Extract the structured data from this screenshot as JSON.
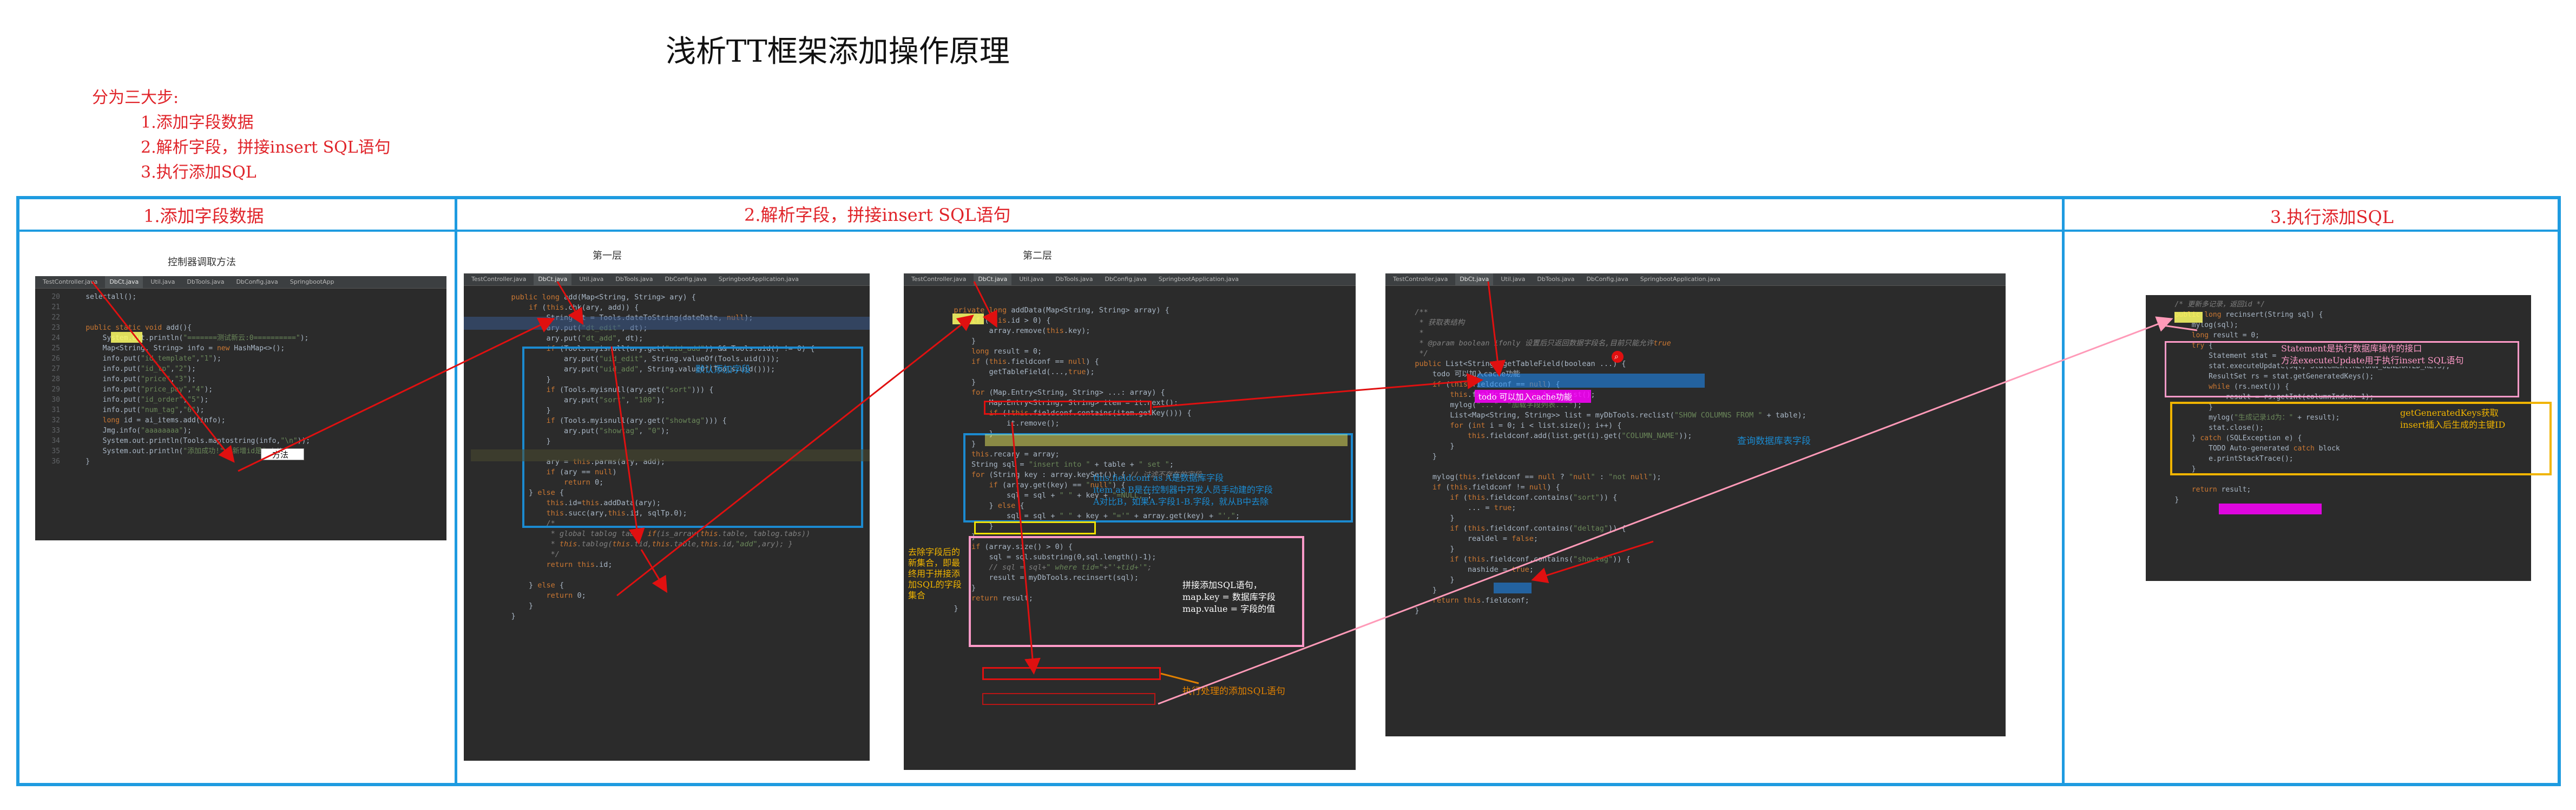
{
  "title": "浅析TT框架添加操作原理",
  "steps": {
    "intro": "分为三大步:",
    "items": [
      "1.添加字段数据",
      "2.解析字段，拼接insert SQL语句",
      "3.执行添加SQL"
    ]
  },
  "sections": {
    "s1": "1.添加字段数据",
    "s2": "2.解析字段，拼接insert SQL语句",
    "s3": "3.执行添加SQL"
  },
  "labels": {
    "p1_caption": "控制器调取方法",
    "p2_caption": "第一层",
    "p3_caption": "第二层"
  },
  "panel1": {
    "tabs": [
      "TestController.java",
      "DbCt.java",
      "Util.java",
      "DbTools.java",
      "DbConfig.java",
      "SpringbootApp"
    ],
    "lines": [
      {
        "n": "20",
        "t": "    selectall();"
      },
      {
        "n": "21",
        "t": ""
      },
      {
        "n": "22",
        "t": ""
      },
      {
        "n": "23",
        "t": "    public static void add(){"
      },
      {
        "n": "24",
        "t": "        System.out.println(\"=======测试新云:0==========\");"
      },
      {
        "n": "25",
        "t": "        Map<String, String> info = new HashMap<>();"
      },
      {
        "n": "26",
        "t": "        info.put(\"id_template\",\"1\");"
      },
      {
        "n": "27",
        "t": "        info.put(\"id_tp\",\"2\");"
      },
      {
        "n": "28",
        "t": "        info.put(\"price\",\"3\");"
      },
      {
        "n": "29",
        "t": "        info.put(\"price_pay\",\"4\");"
      },
      {
        "n": "30",
        "t": "        info.put(\"id_order\",\"5\");"
      },
      {
        "n": "31",
        "t": "        info.put(\"num_tag\",\"6\");"
      },
      {
        "n": "32",
        "t": "        long id = ai_items.add(info);"
      },
      {
        "n": "33",
        "t": "        Jmg.info(\"aaaaaaaa\");"
      },
      {
        "n": "34",
        "t": "        System.out.println(Tools.maptostring(info,\"\\n\"));"
      },
      {
        "n": "35",
        "t": "        System.out.println(\"添加成功!\"+\"新增id是\"+id);"
      },
      {
        "n": "36",
        "t": "    }"
      }
    ],
    "method_tag": "方法"
  },
  "panel2": {
    "tabs": [
      "TestController.java",
      "DbCt.java",
      "Util.java",
      "DbTools.java",
      "DbConfig.java",
      "SpringbootApplication.java"
    ],
    "lines": [
      "    public long add(Map<String, String> ary) {",
      "        if (this.chk(ary, add)) {",
      "            String dt = Tools.dateToString(dateDate, null);",
      "            ary.put(\"dt_edit\", dt);",
      "            ary.put(\"dt_add\", dt);",
      "            if (Tools.myisnull(ary.get(\"uid_add\")) && Tools.uid() != 0) {",
      "                ary.put(\"uid_edit\", String.valueOf(Tools.uid()));",
      "                ary.put(\"uid_add\", String.valueOf(Tools.uid()));",
      "            }",
      "            if (Tools.myisnull(ary.get(\"sort\"))) {",
      "                ary.put(\"sort\", \"100\");",
      "            }",
      "            if (Tools.myisnull(ary.get(\"showtag\"))) {",
      "                ary.put(\"showtag\", \"0\");",
      "            }",
      "",
      "            ary = this.parms(ary, add);",
      "            if (ary == null)",
      "                return 0;",
      "        } else {",
      "            this.id=this.addData(ary);",
      "            this.succ(ary,this.id, sqlTp.0);",
      "            /*",
      "             * global tablog tabs: if(is_array(this.table, tablog.tabs))",
      "             * this.tablog(this.tid,this.table,this.id,\"add\",ary); }",
      "             */",
      "            return this.id;",
      "",
      "        } else {",
      "            return 0;",
      "        }",
      "    }"
    ],
    "box_note": "默认添加字段"
  },
  "panel3": {
    "tabs": [
      "TestController.java",
      "DbCt.java",
      "Util.java",
      "DbTools.java",
      "DbConfig.java",
      "SpringbootApplication.java"
    ],
    "lines": [
      "    private long addData(Map<String, String> array) {",
      "        if (this.id > 0) {",
      "            array.remove(this.key);",
      "        }",
      "        long result = 0;",
      "        if (this.fieldconf == null) {",
      "            getTableField(...,true);",
      "        }",
      "        for (Map.Entry<String, String> ...: array) {",
      "            Map.Entry<String, String> item = it.next();",
      "            if (!this.fieldconf.contains(item.getKey())) {",
      "                it.remove();",
      "            }",
      "        }",
      "        this.recary = array;",
      "        String sql = \"insert into \" + table + \" set \";",
      "        for (String key : array.keySet()) { // 过滤不存在的字段",
      "            if (array.get(key) == \"null\") {",
      "                sql = sql + \" \" + key + \"=NULL,\";",
      "            } else {",
      "                sql = sql + \" \" + key + \"='\" + array.get(key) + \"',\";",
      "            }",
      "        }",
      "        if (array.size() > 0) {",
      "            sql = sql.substring(0,sql.length()-1);",
      "            // sql = sql+\" where tid=\"+\"'+tid+'\";",
      "            result = myDbTools.recinsert(sql);",
      "        }",
      "        return result;",
      "    }"
    ],
    "notes": {
      "blue": "this.fieldconf as A是数据库字段\nitem as B是在控制器中开发人员手动建的字段\nA对比B，如果A.字段1-B.字段，就从B中去除",
      "left": "去除字段后的新集合，即最终用于拼接添加SQL的字段集合",
      "pink": "拼接添加SQL语句，\nmap.key = 数据库字段\nmap.value = 字段的值",
      "bottom": "执行处理的添加SQL语句"
    }
  },
  "panel4": {
    "tabs": [
      "TestController.java",
      "DbCt.java",
      "Util.java",
      "DbTools.java",
      "DbConfig.java",
      "SpringbootApplication.java"
    ],
    "lines": [
      "   /**",
      "    * 获取表结构",
      "    *",
      "    * @param boolean ifonly 设置后只返回数据字段名,目前只能允许true",
      "    */",
      "   public List<String> getTableField(boolean ...) {",
      "       todo 可以加入cache功能",
      "       if (this.fieldconf == null) {",
      "           this.fieldconf = new ArrayList();",
      "           mylog(\"...\", \"加载字段列表...\");",
      "           List<Map<String, String>> list = myDbTools.reclist(\"SHOW COLUMNS FROM \" + table);",
      "           for (int i = 0; i < list.size(); i++) {",
      "               this.fieldconf.add(list.get(i).get(\"COLUMN_NAME\"));",
      "           }",
      "       }",
      "",
      "       mylog(this.fieldconf == null ? \"null\" : \"not null\");",
      "       if (this.fieldconf != null) {",
      "           if (this.fieldconf.contains(\"sort\")) {",
      "               ... = true;",
      "           }",
      "           if (this.fieldconf.contains(\"deltag\")) {",
      "               realdel = false;",
      "           }",
      "           if (this.fieldconf.contains(\"showtag\")) {",
      "               nashide = true;",
      "           }",
      "       }",
      "       return this.fieldconf;",
      "   }"
    ],
    "notes": {
      "cache": "todo 可以加入cache功能",
      "query": "查询数据库表字段"
    }
  },
  "panel5": {
    "lines": [
      "   /* 更新多记录，返回id */",
      "   public long recinsert(String sql) {",
      "       mylog(sql);",
      "       long result = 0;",
      "       try {",
      "           Statement stat = this.conn.createStatement();",
      "           stat.executeUpdate(sql, Statement.RETURN_GENERATED_KEYS);",
      "           ResultSet rs = stat.getGeneratedKeys();",
      "           while (rs.next()) {",
      "               result = rs.getInt(columnIndex: 1);",
      "           }",
      "           mylog(\"生成记录id为：\" + result);",
      "           stat.close();",
      "       } catch (SQLException e) {",
      "           TODO Auto-generated catch block",
      "           e.printStackTrace();",
      "       }",
      "",
      "       return result;",
      "   }"
    ],
    "notes": {
      "statement": "Statement是执行数据库操作的接口\n方法executeUpdate用于执行insert SQL语句",
      "keys": "getGeneratedKeys获取\ninsert插入后生成的主键ID"
    }
  },
  "colors": {
    "frame": "#1e9be0",
    "step_red": "#e0242a",
    "arrow_red": "#e01010",
    "arrow_pink": "#ff9ab8",
    "box_blue": "#1b8ad0",
    "box_pink": "#ff9ac8",
    "box_yellow": "#f0b400",
    "highlight_yellow": "#ffff66",
    "highlight_magenta": "#ff00ff"
  }
}
